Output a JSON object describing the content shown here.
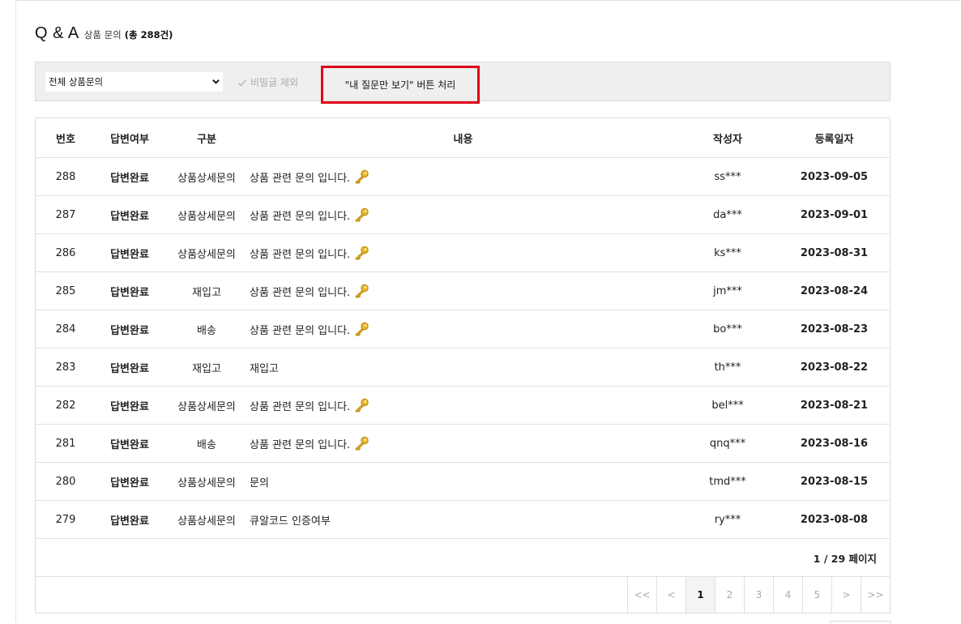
{
  "header": {
    "title": "Q & A",
    "subtitle": "상품 문의",
    "count_label": "(총 288건)"
  },
  "filter": {
    "select_value": "전체 상품문의",
    "secret_exclude_label": "비밀글 제외",
    "my_questions_label": "\"내 질문만 보기\" 버튼 처리"
  },
  "table": {
    "columns": [
      "번호",
      "답변여부",
      "구분",
      "내용",
      "작성자",
      "등록일자"
    ],
    "rows": [
      {
        "num": "288",
        "status": "답변완료",
        "category": "상품상세문의",
        "content": "상품 관련 문의 입니다.",
        "secret": true,
        "writer": "ss***",
        "date": "2023-09-05"
      },
      {
        "num": "287",
        "status": "답변완료",
        "category": "상품상세문의",
        "content": "상품 관련 문의 입니다.",
        "secret": true,
        "writer": "da***",
        "date": "2023-09-01"
      },
      {
        "num": "286",
        "status": "답변완료",
        "category": "상품상세문의",
        "content": "상품 관련 문의 입니다.",
        "secret": true,
        "writer": "ks***",
        "date": "2023-08-31"
      },
      {
        "num": "285",
        "status": "답변완료",
        "category": "재입고",
        "content": "상품 관련 문의 입니다.",
        "secret": true,
        "writer": "jm***",
        "date": "2023-08-24"
      },
      {
        "num": "284",
        "status": "답변완료",
        "category": "배송",
        "content": "상품 관련 문의 입니다.",
        "secret": true,
        "writer": "bo***",
        "date": "2023-08-23"
      },
      {
        "num": "283",
        "status": "답변완료",
        "category": "재입고",
        "content": "재입고",
        "secret": false,
        "writer": "th***",
        "date": "2023-08-22"
      },
      {
        "num": "282",
        "status": "답변완료",
        "category": "상품상세문의",
        "content": "상품 관련 문의 입니다.",
        "secret": true,
        "writer": "bel***",
        "date": "2023-08-21"
      },
      {
        "num": "281",
        "status": "답변완료",
        "category": "배송",
        "content": "상품 관련 문의 입니다.",
        "secret": true,
        "writer": "qnq***",
        "date": "2023-08-16"
      },
      {
        "num": "280",
        "status": "답변완료",
        "category": "상품상세문의",
        "content": "문의",
        "secret": false,
        "writer": "tmd***",
        "date": "2023-08-15"
      },
      {
        "num": "279",
        "status": "답변완료",
        "category": "상품상세문의",
        "content": "큐알코드 인증여부",
        "secret": false,
        "writer": "ry***",
        "date": "2023-08-08"
      }
    ]
  },
  "page_info": "1 / 29 페이지",
  "pagination": {
    "first": "<<",
    "prev": "<",
    "pages": [
      "1",
      "2",
      "3",
      "4",
      "5"
    ],
    "current": "1",
    "next": ">",
    "last": ">>"
  },
  "icons": {
    "secret": "key-icon",
    "select": "chevron-down-icon",
    "check": "check-icon"
  },
  "colors": {
    "highlight_border": "#e0001a",
    "filter_bg": "#efefef",
    "key_gold": "#d9a520"
  }
}
